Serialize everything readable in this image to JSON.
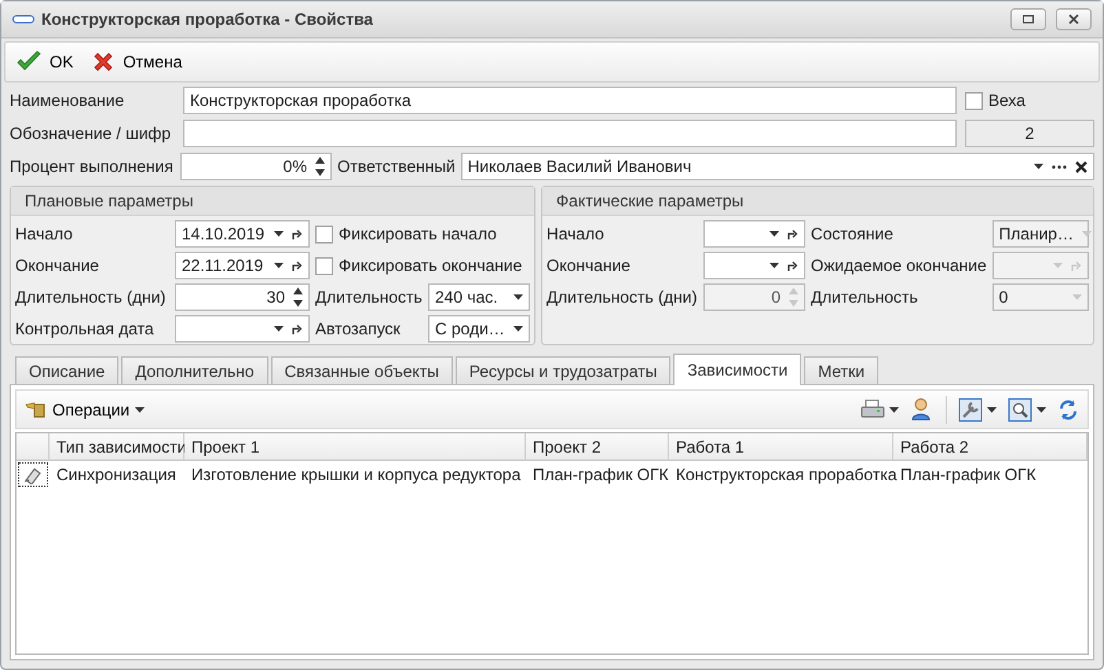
{
  "window": {
    "title": "Конструкторская проработка - Свойства"
  },
  "toolbar": [
    {
      "label": "OK",
      "kind": "ok"
    },
    {
      "label": "Отмена",
      "kind": "cancel"
    }
  ],
  "name": {
    "label": "Наименование",
    "value": "Конструкторская проработка"
  },
  "milestone": {
    "label": "Веха",
    "checked": false
  },
  "code": {
    "label": "Обозначение / шифр",
    "number": "2"
  },
  "percent": {
    "label": "Процент выполнения",
    "value": "0%"
  },
  "responsible": {
    "label": "Ответственный",
    "value": "Николаев Василий Иванович"
  },
  "groups": [
    {
      "title": "Плановые параметры",
      "rows": [
        [
          {
            "kind": "label",
            "text": "Начало"
          },
          {
            "kind": "date",
            "value": "14.10.2019",
            "disabled": false
          },
          {
            "kind": "check",
            "text": "Фиксировать начало",
            "checked": false,
            "disabled": false
          }
        ],
        [
          {
            "kind": "label",
            "text": "Окончание"
          },
          {
            "kind": "date",
            "value": "22.11.2019",
            "disabled": false
          },
          {
            "kind": "check",
            "text": "Фиксировать окончание",
            "checked": false,
            "disabled": false
          }
        ],
        [
          {
            "kind": "label",
            "text": "Длительность (дни)"
          },
          {
            "kind": "spin",
            "value": "30",
            "disabled": false
          },
          {
            "kind": "label",
            "text": "Длительность"
          },
          {
            "kind": "combo",
            "value": "240 час.",
            "disabled": false
          }
        ],
        [
          {
            "kind": "label",
            "text": "Контрольная дата"
          },
          {
            "kind": "date",
            "disabled": false
          },
          {
            "kind": "label",
            "text": "Автозапуск"
          },
          {
            "kind": "combo",
            "value": "С роди…",
            "disabled": false
          }
        ]
      ]
    },
    {
      "title": "Фактические параметры",
      "rows": [
        [
          {
            "kind": "label",
            "text": "Начало"
          },
          {
            "kind": "date",
            "disabled": false
          },
          {
            "kind": "label",
            "text": "Состояние"
          },
          {
            "kind": "combo",
            "value": "Планир…",
            "disabled": true
          }
        ],
        [
          {
            "kind": "label",
            "text": "Окончание"
          },
          {
            "kind": "date",
            "disabled": false
          },
          {
            "kind": "label",
            "text": "Ожидаемое окончание"
          },
          {
            "kind": "date",
            "disabled": true
          }
        ],
        [
          {
            "kind": "label",
            "text": "Длительность (дни)"
          },
          {
            "kind": "spin",
            "value": "0",
            "disabled": true
          },
          {
            "kind": "label",
            "text": "Длительность"
          },
          {
            "kind": "combo",
            "value": "0",
            "disabled": true
          }
        ]
      ]
    }
  ],
  "tabs": [
    {
      "label": "Описание",
      "selected": false
    },
    {
      "label": "Дополнительно",
      "selected": false
    },
    {
      "label": "Связанные объекты",
      "selected": false
    },
    {
      "label": "Ресурсы и трудозатраты",
      "selected": false
    },
    {
      "label": "Зависимости",
      "selected": true
    },
    {
      "label": "Метки",
      "selected": false
    }
  ],
  "operations": {
    "label": "Операции"
  },
  "table": {
    "columns": [
      "Тип зависимости",
      "Проект 1",
      "Проект 2",
      "Работа 1",
      "Работа 2"
    ],
    "rows": [
      {
        "cells": [
          "Синхронизация",
          "Изготовление крышки и корпуса редуктора",
          "План-график ОГК",
          "Конструкторская проработка",
          "План-график ОГК"
        ],
        "selected": false
      }
    ]
  }
}
